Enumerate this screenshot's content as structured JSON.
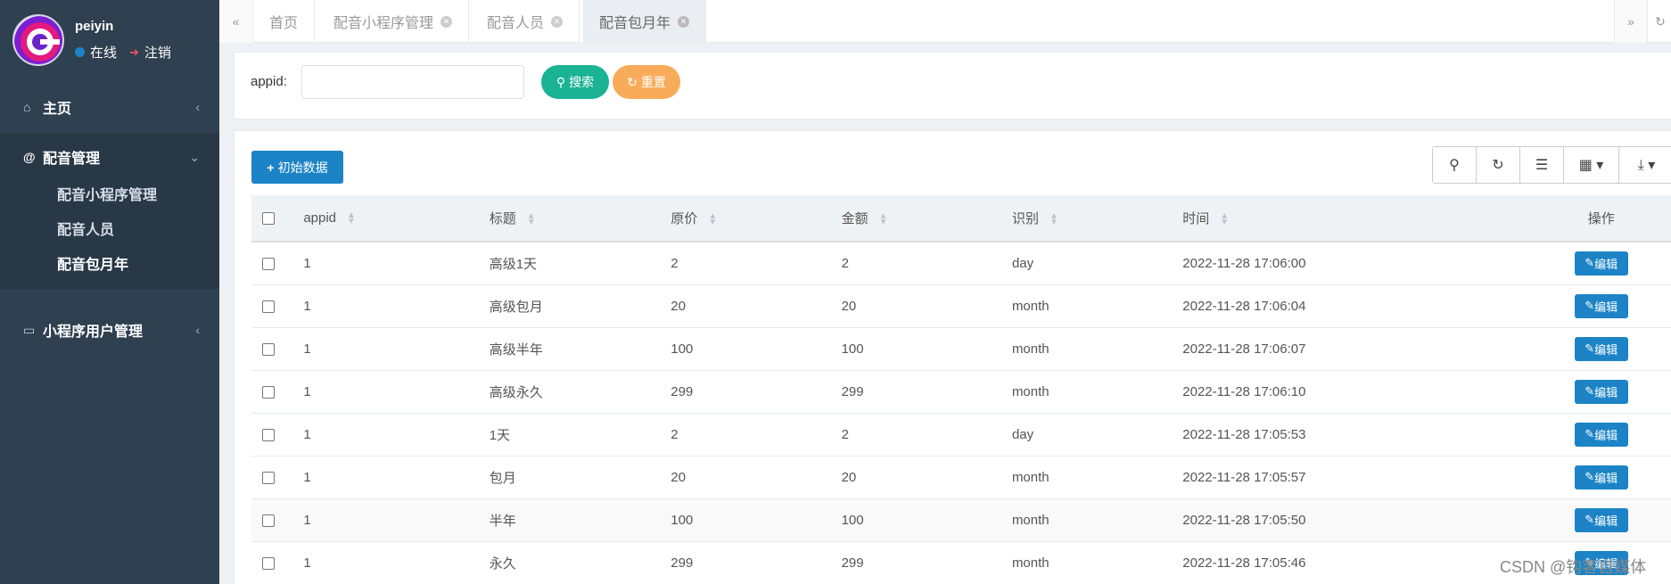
{
  "sidebar": {
    "username": "peiyin",
    "status": "在线",
    "logout": "注销",
    "nav": {
      "home": "主页",
      "dubbing": "配音管理",
      "dubbing_items": [
        "配音小程序管理",
        "配音人员",
        "配音包月年"
      ],
      "mini_users": "小程序用户管理"
    }
  },
  "tabs": [
    "首页",
    "配音小程序管理",
    "配音人员",
    "配音包月年"
  ],
  "search": {
    "label": "appid:",
    "value": "",
    "search_btn": "搜索",
    "reset_btn": "重置"
  },
  "toolbar": {
    "init_btn": "初始数据"
  },
  "table": {
    "columns": [
      "appid",
      "标题",
      "原价",
      "金额",
      "识别",
      "时间",
      "操作"
    ],
    "edit_label": "编辑",
    "rows": [
      [
        "1",
        "高级1天",
        "2",
        "2",
        "day",
        "2022-11-28 17:06:00"
      ],
      [
        "1",
        "高级包月",
        "20",
        "20",
        "month",
        "2022-11-28 17:06:04"
      ],
      [
        "1",
        "高级半年",
        "100",
        "100",
        "month",
        "2022-11-28 17:06:07"
      ],
      [
        "1",
        "高级永久",
        "299",
        "299",
        "month",
        "2022-11-28 17:06:10"
      ],
      [
        "1",
        "1天",
        "2",
        "2",
        "day",
        "2022-11-28 17:05:53"
      ],
      [
        "1",
        "包月",
        "20",
        "20",
        "month",
        "2022-11-28 17:05:57"
      ],
      [
        "1",
        "半年",
        "100",
        "100",
        "month",
        "2022-11-28 17:05:50"
      ],
      [
        "1",
        "永久",
        "299",
        "299",
        "month",
        "2022-11-28 17:05:46"
      ]
    ]
  },
  "watermark": "CSDN @钩客自媒体",
  "colors": {
    "sidebar": "#2f4050",
    "primary": "#1c84c6",
    "success": "#1ab394",
    "warning": "#f8ac59"
  }
}
